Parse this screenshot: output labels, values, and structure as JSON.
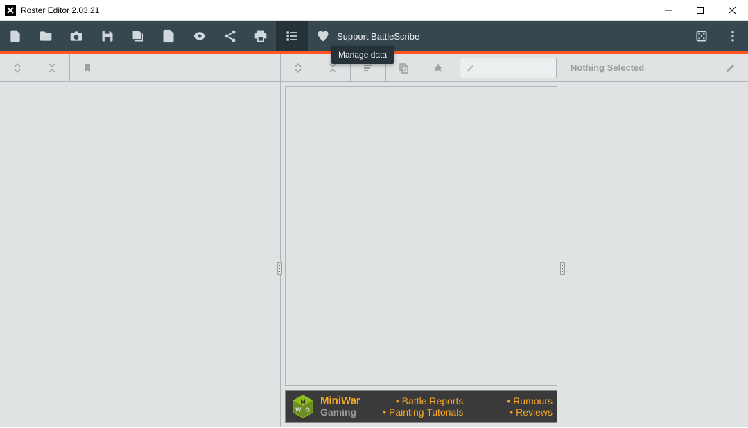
{
  "window": {
    "title": "Roster Editor 2.03.21"
  },
  "toolbar": {
    "support_label": "Support BattleScribe"
  },
  "tooltip": {
    "manage_data": "Manage data"
  },
  "detail_panel": {
    "nothing_selected": "Nothing Selected"
  },
  "ad": {
    "brand_top": "MiniWar",
    "brand_bottom": "Gaming",
    "links": {
      "battle_reports": "• Battle Reports",
      "rumours": "• Rumours",
      "painting": "• Painting Tutorials",
      "reviews": "• Reviews"
    }
  }
}
